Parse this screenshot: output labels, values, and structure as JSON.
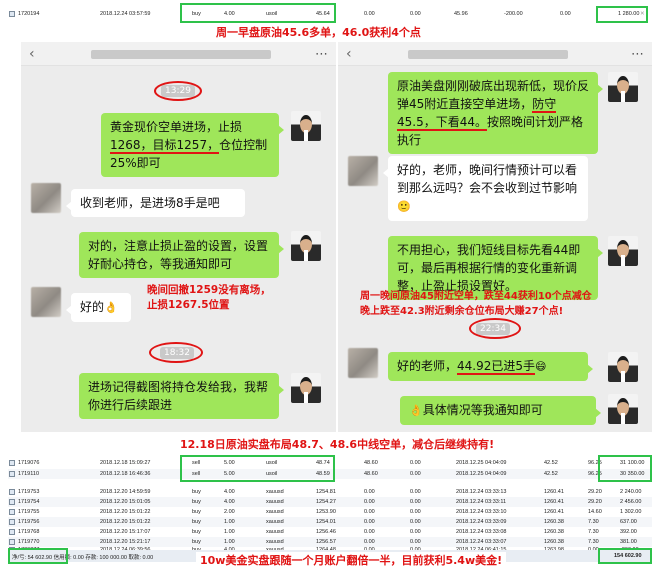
{
  "top_trade": {
    "ticket": "1720194",
    "open_time": "2018.12.24 03:57:59",
    "type": "buy",
    "volume": "4.00",
    "symbol": "usoil",
    "open_price": "45.64",
    "sl": "0.00",
    "tp": "0.00",
    "close_time": "",
    "close_price": "45.96",
    "commission": "-200.00",
    "swap": "0.00",
    "profit": "1 280.00",
    "close_mark": "✕"
  },
  "caption_top": "周一早盘原油45.6多单，46.0获利4个点",
  "chat_left": {
    "time_label": "13:29",
    "msg1_a": "黄金现价空单进场，止损",
    "msg1_b": "1268，目标1257，",
    "msg1_c": "仓位控制25%即可",
    "msg2": "收到老师，是进场8手是吧",
    "msg3": "对的，注意止损止盈的设置，设置好耐心持仓，等我通知即可",
    "msg4": "好的",
    "msg4_emoji": "👌",
    "red_note_1": "晚间回撤1259没有离场，",
    "red_note_2": "止损1267.5位置",
    "time_label_2": "18:32",
    "msg5": "进场记得截图将持仓发给我，我帮你进行后续跟进"
  },
  "chat_right": {
    "msg1_a": "原油美盘刚刚破底出现新低，现价反弹45附近直接空单进场，",
    "msg1_b": "防守45.5，下看44。",
    "msg1_c": "按照晚间计划严格执行",
    "msg2": "好的，老师，晚间行情预计可以看到那么远吗？会不会收到过节影响",
    "msg2_emoji": "🙂",
    "msg3": "不用担心，我们短线目标先看44即可，最后再根据行情的变化重新调整，止盈止损设置好。",
    "red_note_1": "周一晚间原油45附近空单，跌至44获利10个点减仓",
    "red_note_2": "晚上跌至42.3附近剩余仓位布局大赚27个点!",
    "time_label": "22:34",
    "msg4_a": "好的老师，",
    "msg4_b": "44.92已进5手",
    "msg4_emoji": "😄",
    "msg5_emoji": "👌",
    "msg5": "具体情况等我通知即可"
  },
  "caption_mid": "12.18日原油实盘布局48.7、48.6中线空单，减仓后继续持有!",
  "trades": [
    {
      "ticket": "1719076",
      "open_time": "2018.12.18 15:09:27",
      "type": "sell",
      "volume": "5.00",
      "symbol": "usoil",
      "open_price": "48.74",
      "sl": "48.60",
      "tp": "0.00",
      "close_time": "2018.12.25 04:04:09",
      "close_price": "42.52",
      "commission": "96.25",
      "swap": "0.00",
      "profit": "31 100.00"
    },
    {
      "ticket": "1719110",
      "open_time": "2018.12.18 16:46:36",
      "type": "sell",
      "volume": "5.00",
      "symbol": "usoil",
      "open_price": "48.59",
      "sl": "48.60",
      "tp": "0.00",
      "close_time": "2018.12.25 04:04:09",
      "close_price": "42.52",
      "commission": "96.25",
      "swap": "0.00",
      "profit": "30 350.00"
    },
    {
      "ticket": "1719753",
      "open_time": "2018.12.20 14:59:59",
      "type": "buy",
      "volume": "4.00",
      "symbol": "xauusd",
      "open_price": "1254.81",
      "sl": "0.00",
      "tp": "0.00",
      "close_time": "2018.12.24 03:33:13",
      "close_price": "1260.41",
      "commission": "29.20",
      "swap": "0.00",
      "profit": "2 240.00"
    },
    {
      "ticket": "1719754",
      "open_time": "2018.12.20 15:01:05",
      "type": "buy",
      "volume": "4.00",
      "symbol": "xauusd",
      "open_price": "1254.27",
      "sl": "0.00",
      "tp": "0.00",
      "close_time": "2018.12.24 03:33:11",
      "close_price": "1260.41",
      "commission": "29.20",
      "swap": "0.00",
      "profit": "2 456.00"
    },
    {
      "ticket": "1719755",
      "open_time": "2018.12.20 15:01:22",
      "type": "buy",
      "volume": "2.00",
      "symbol": "xauusd",
      "open_price": "1253.90",
      "sl": "0.00",
      "tp": "0.00",
      "close_time": "2018.12.24 03:33:10",
      "close_price": "1260.41",
      "commission": "14.60",
      "swap": "0.00",
      "profit": "1 302.00"
    },
    {
      "ticket": "1719756",
      "open_time": "2018.12.20 15:01:22",
      "type": "buy",
      "volume": "1.00",
      "symbol": "xauusd",
      "open_price": "1254.01",
      "sl": "0.00",
      "tp": "0.00",
      "close_time": "2018.12.24 03:33:09",
      "close_price": "1260.38",
      "commission": "7.30",
      "swap": "0.00",
      "profit": "637.00"
    },
    {
      "ticket": "1719768",
      "open_time": "2018.12.20 15:17:07",
      "type": "buy",
      "volume": "1.00",
      "symbol": "xauusd",
      "open_price": "1256.46",
      "sl": "0.00",
      "tp": "0.00",
      "close_time": "2018.12.24 03:33:08",
      "close_price": "1260.38",
      "commission": "7.30",
      "swap": "0.00",
      "profit": "392.00"
    },
    {
      "ticket": "1719770",
      "open_time": "2018.12.20 15:21:17",
      "type": "buy",
      "volume": "1.00",
      "symbol": "xauusd",
      "open_price": "1256.57",
      "sl": "0.00",
      "tp": "0.00",
      "close_time": "2018.12.24 03:33:07",
      "close_price": "1260.38",
      "commission": "7.30",
      "swap": "0.00",
      "profit": "381.00"
    },
    {
      "ticket": "1720277",
      "open_time": "2018.12.24 06:39:56",
      "type": "buy",
      "volume": "4.00",
      "symbol": "xauusd",
      "open_price": "1264.48",
      "sl": "0.00",
      "tp": "0.00",
      "close_time": "2018.12.24 06:41:15",
      "close_price": "1263.98",
      "commission": "0.00",
      "swap": "0.00",
      "profit": "-200.00"
    }
  ],
  "status_bar": {
    "left": "净/亏: 54 602.90  信用额: 0.00  存款: 100 000.00  取款: 0.00",
    "right": "154 602.90"
  },
  "caption_bottom": "10w美金实盘跟随一个月账户翻倍一半，目前获利5.4w美金!",
  "colors": {
    "highlight_box": "#2ec24a",
    "annotation_red": "#e01414",
    "bubble_green": "#9fe65a",
    "chat_bg": "#ececec"
  }
}
